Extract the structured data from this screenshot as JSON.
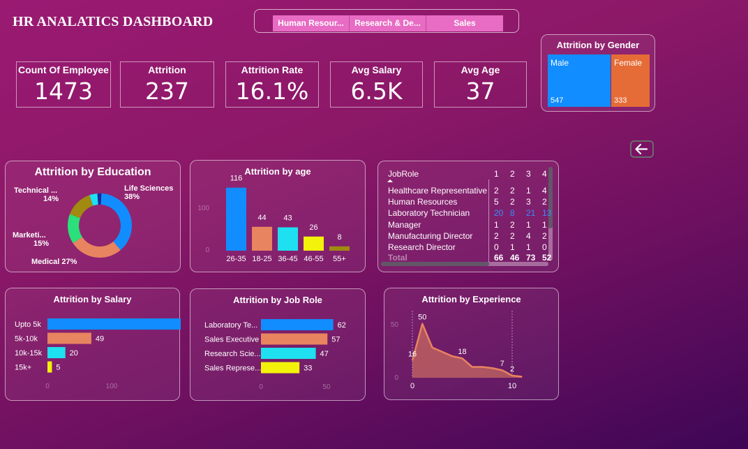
{
  "header": {
    "title": "HR ANALATICS  DASHBOARD"
  },
  "department_slicer": {
    "options": [
      "Human Resour...",
      "Research & De...",
      "Sales"
    ]
  },
  "kpis": [
    {
      "label": "Count Of Employee",
      "value": "1473"
    },
    {
      "label": "Attrition",
      "value": "237"
    },
    {
      "label": "Attrition Rate",
      "value": "16.1%"
    },
    {
      "label": "Avg Salary",
      "value": "6.5K"
    },
    {
      "label": "Avg Age",
      "value": "37"
    }
  ],
  "gender": {
    "title": "Attrition by Gender",
    "items": [
      {
        "name": "Male",
        "value": "547",
        "color": "#118dff"
      },
      {
        "name": "Female",
        "value": "333",
        "color": "#e66c37"
      }
    ]
  },
  "colors": {
    "blue": "#118dff",
    "orange": "#e8845f",
    "cyan": "#1fe0f0",
    "yellow": "#f2f20a",
    "olive": "#a08a10",
    "green": "#2ae07a",
    "navy": "#1a2a9a"
  },
  "chart_data": [
    {
      "type": "pie",
      "title": "Attrition by Education",
      "slices": [
        {
          "label": "Life Sciences",
          "percent": 38,
          "color": "#118dff"
        },
        {
          "label": "Medical",
          "percent": 27,
          "color": "#e8845f"
        },
        {
          "label": "Marketi...",
          "percent": 15,
          "color": "#2ae07a"
        },
        {
          "label": "Technical ...",
          "percent": 14,
          "color": "#a08a10"
        },
        {
          "label": "",
          "percent": 4,
          "color": "#1fe0f0"
        },
        {
          "label": "",
          "percent": 2,
          "color": "#1a2a9a"
        }
      ],
      "labels_text": [
        {
          "name": "Life Sciences",
          "pct": "38%"
        },
        {
          "name": "Technical ...",
          "pct": "14%"
        },
        {
          "name": "Marketi...",
          "pct": "15%"
        },
        {
          "name": "Medical",
          "pct": "27%"
        }
      ]
    },
    {
      "type": "bar",
      "title": "Attrition by age",
      "categories": [
        "26-35",
        "18-25",
        "36-45",
        "46-55",
        "55+"
      ],
      "values": [
        116,
        44,
        43,
        26,
        8
      ],
      "colors": [
        "#118dff",
        "#e8845f",
        "#1fe0f0",
        "#f2f20a",
        "#a08a10"
      ],
      "ylim": [
        0,
        130
      ],
      "yticks": [
        "0",
        "100"
      ]
    },
    {
      "type": "bar",
      "title": "Attrition by Salary",
      "categories": [
        "Upto 5k",
        "5k-10k",
        "10k-15k",
        "15k+"
      ],
      "values": [
        163,
        49,
        20,
        5
      ],
      "colors": [
        "#118dff",
        "#e8845f",
        "#1fe0f0",
        "#f2f20a"
      ],
      "xlim": [
        0,
        180
      ],
      "xticks": [
        "0",
        "100"
      ]
    },
    {
      "type": "bar",
      "title": "Attrition by Job Role",
      "categories": [
        "Laboratory Te...",
        "Sales Executive",
        "Research Scie...",
        "Sales Represe..."
      ],
      "values": [
        62,
        57,
        47,
        33
      ],
      "colors": [
        "#118dff",
        "#e8845f",
        "#1fe0f0",
        "#f2f20a"
      ],
      "xlim": [
        0,
        70
      ],
      "xticks": [
        "0",
        "50"
      ]
    },
    {
      "type": "area",
      "title": "Attrition by Experience",
      "x": [
        0,
        1,
        2,
        3,
        4,
        5,
        6,
        7,
        8,
        9,
        10,
        11
      ],
      "y": [
        16,
        50,
        28,
        24,
        20,
        18,
        10,
        10,
        9,
        7,
        2,
        1
      ],
      "point_labels": [
        {
          "i": 0,
          "text": "16"
        },
        {
          "i": 1,
          "text": "50"
        },
        {
          "i": 5,
          "text": "18"
        },
        {
          "i": 9,
          "text": "7"
        },
        {
          "i": 10,
          "text": "2"
        }
      ],
      "xlim": [
        0,
        12
      ],
      "ylim": [
        0,
        55
      ],
      "yticks": [
        "0",
        "50"
      ],
      "xticks": [
        "0",
        "10"
      ]
    }
  ],
  "jobrole_table": {
    "header": [
      "JobRole",
      "1",
      "2",
      "3",
      "4"
    ],
    "rows": [
      [
        "Healthcare Representative",
        "2",
        "2",
        "1",
        "4"
      ],
      [
        "Human Resources",
        "5",
        "2",
        "3",
        "2"
      ],
      [
        "Laboratory Technician",
        "20",
        "8",
        "21",
        "13"
      ],
      [
        "Manager",
        "1",
        "2",
        "1",
        "1"
      ],
      [
        "Manufacturing Director",
        "2",
        "2",
        "4",
        "2"
      ],
      [
        "Research Director",
        "0",
        "1",
        "1",
        "0"
      ]
    ],
    "total": [
      "Total",
      "66",
      "46",
      "73",
      "52"
    ]
  }
}
